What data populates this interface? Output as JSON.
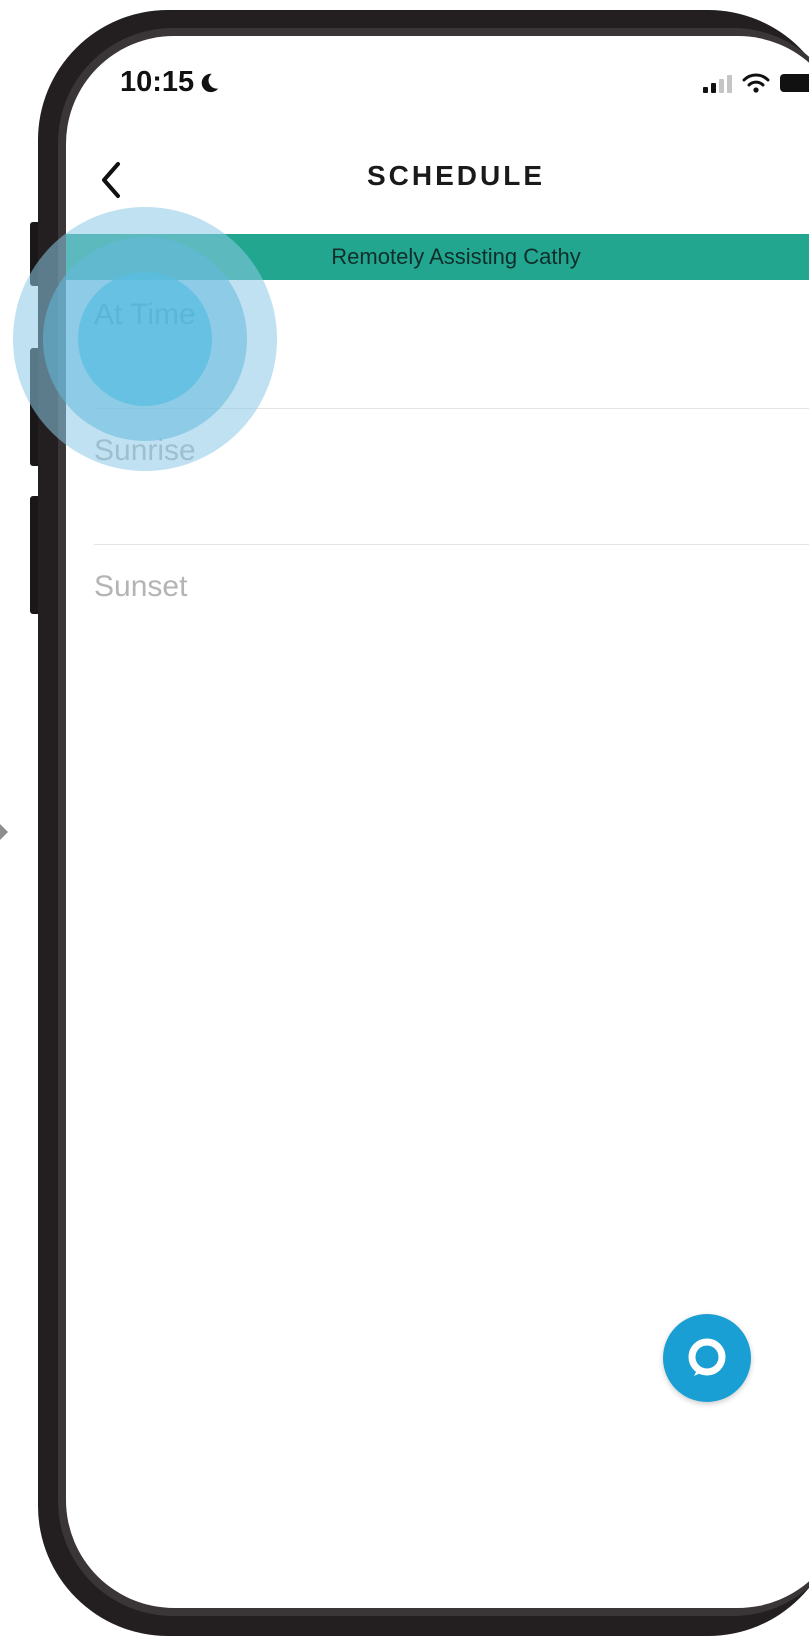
{
  "status_bar": {
    "time": "10:15",
    "icons": [
      "moon-icon",
      "signal-icon",
      "wifi-icon",
      "battery-icon"
    ]
  },
  "header": {
    "title": "SCHEDULE",
    "back_icon": "chevron-left-icon"
  },
  "banner": {
    "text": "Remotely Assisting Cathy",
    "color": "#22a68f"
  },
  "options": [
    {
      "label": "At Time",
      "enabled": true
    },
    {
      "label": "Sunrise",
      "enabled": false
    },
    {
      "label": "Sunset",
      "enabled": false
    }
  ],
  "alexa_button": {
    "icon": "alexa-icon",
    "color": "#1a9fd4"
  },
  "tap_highlight_color": "#5bbfe0"
}
